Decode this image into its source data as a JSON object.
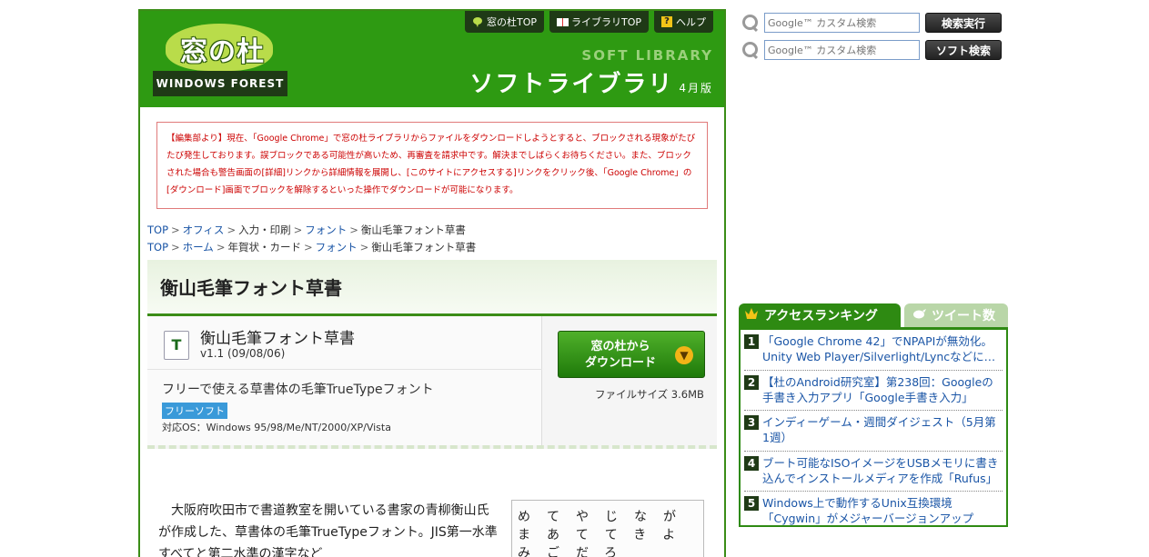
{
  "header": {
    "logo_kanji": "窓の杜",
    "logo_sub": "WINDOWS FOREST",
    "nav": [
      {
        "label": "窓の杜TOP",
        "icon": "speech-bubble-icon"
      },
      {
        "label": "ライブラリTOP",
        "icon": "book-icon"
      },
      {
        "label": "ヘルプ",
        "icon": "question-icon"
      }
    ],
    "soft_library": "SOFT LIBRARY",
    "library_title": "ソフトライブラリ",
    "edition": "4月版"
  },
  "notice": "【編集部より】現在、「Google Chrome」で窓の杜ライブラリからファイルをダウンロードしようとすると、ブロックされる現象がたびたび発生しております。誤ブロックである可能性が高いため、再審査を請求中です。解決までしばらくお待ちください。また、ブロックされた場合も警告画面の[詳細]リンクから詳細情報を展開し、[このサイトにアクセスする]リンクをクリック後、「Google Chrome」の[ダウンロード]画面でブロックを解除するといった操作でダウンロードが可能になります。",
  "breadcrumbs": [
    [
      {
        "label": "TOP",
        "link": true
      },
      {
        "label": "オフィス",
        "link": true
      },
      {
        "label": "入力・印刷",
        "link": false
      },
      {
        "label": "フォント",
        "link": true
      },
      {
        "label": "衡山毛筆フォント草書",
        "link": false
      }
    ],
    [
      {
        "label": "TOP",
        "link": true
      },
      {
        "label": "ホーム",
        "link": true
      },
      {
        "label": "年賀状・カード",
        "link": false
      },
      {
        "label": "フォント",
        "link": true
      },
      {
        "label": "衡山毛筆フォント草書",
        "link": false
      }
    ]
  ],
  "page_title": "衡山毛筆フォント草書",
  "software": {
    "icon_letter": "T",
    "name": "衡山毛筆フォント草書",
    "version": "v1.1 (09/08/06)",
    "description": "フリーで使える草書体の毛筆TrueTypeフォント",
    "badge": "フリーソフト",
    "os": "対応OS：Windows 95/98/Me/NT/2000/XP/Vista",
    "download_line1": "窓の杜から",
    "download_line2": "ダウンロード",
    "file_size": "ファイルサイズ 3.6MB"
  },
  "body": {
    "paragraph": "大阪府吹田市で書道教室を開いている書家の青柳衡山氏が作成した、草書体の毛筆TrueTypeフォント。JIS第一水準すべてと第二水準の漢字など",
    "calligraphy_sample": "めてやじながまあててきよみごだろ"
  },
  "search": [
    {
      "placeholder": "Google™ カスタム検索",
      "button": "検索実行"
    },
    {
      "placeholder": "Google™ カスタム検索",
      "button": "ソフト検索"
    }
  ],
  "ranking": {
    "tab_access": "アクセスランキング",
    "tab_tweet": "ツイート数",
    "items": [
      {
        "num": "1",
        "text": "「Google Chrome 42」でNPAPIが無効化。Unity Web Player/Silverlight/Lyncなどに…"
      },
      {
        "num": "2",
        "text": "【杜のAndroid研究室】第238回：Googleの手書き入力アプリ「Google手書き入力」"
      },
      {
        "num": "3",
        "text": "インディーゲーム・週間ダイジェスト（5月第1週）"
      },
      {
        "num": "4",
        "text": "ブート可能なISOイメージをUSBメモリに書き込んでインストールメディアを作成「Rufus」"
      },
      {
        "num": "5",
        "text": "Windows上で動作するUnix互換環境「Cygwin」がメジャーバージョンアップ"
      }
    ]
  }
}
